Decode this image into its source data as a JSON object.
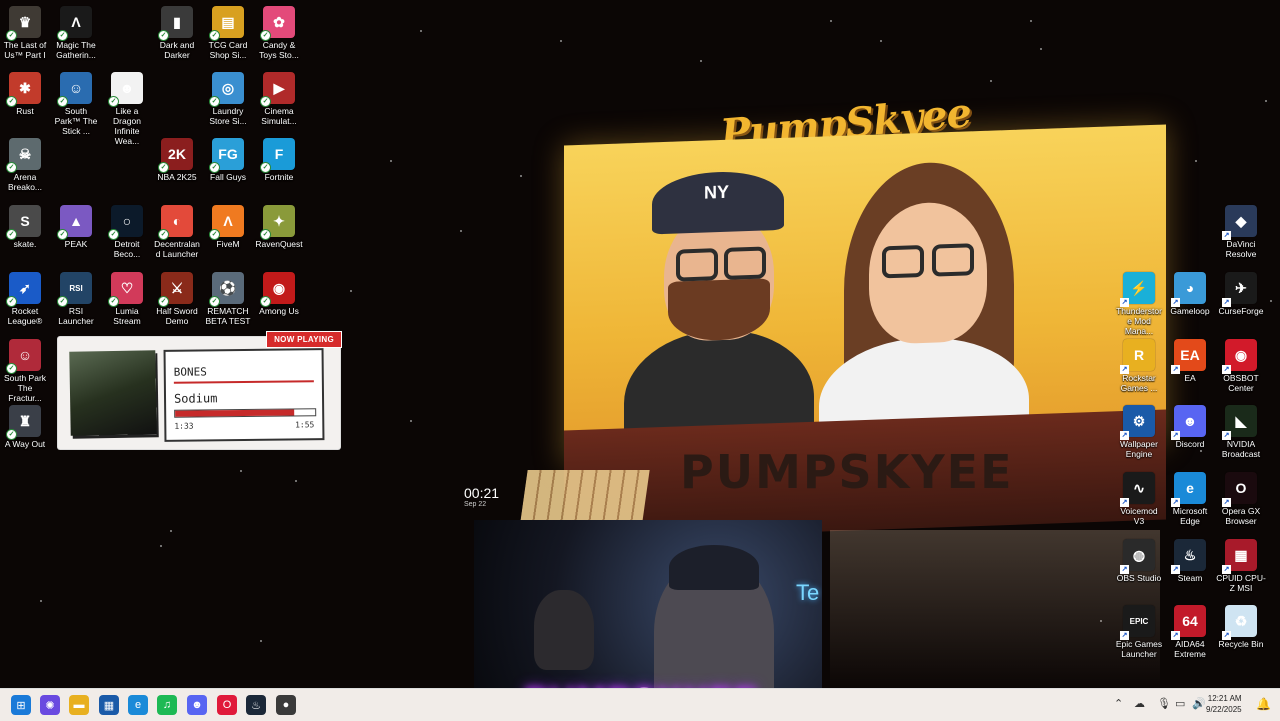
{
  "desktop": {
    "icons_left": [
      {
        "id": "tlou",
        "label": "The Last of Us™ Part I",
        "color": "#3f3a34",
        "glyph": "♛"
      },
      {
        "id": "magic",
        "label": "Magic The Gatherin...",
        "color": "#1a1a1a",
        "glyph": "Λ"
      },
      {
        "id": "dark",
        "label": "Dark and Darker",
        "color": "#3a3a3a",
        "glyph": "▮"
      },
      {
        "id": "tcg",
        "label": "TCG Card Shop Si...",
        "color": "#d8a020",
        "glyph": "▤"
      },
      {
        "id": "candy",
        "label": "Candy & Toys Sto...",
        "color": "#e34a7a",
        "glyph": "✿"
      },
      {
        "id": "rust",
        "label": "Rust",
        "color": "#c23b2b",
        "glyph": "✱"
      },
      {
        "id": "southpark",
        "label": "South Park™ The Stick ...",
        "color": "#2a6cb0",
        "glyph": "☺"
      },
      {
        "id": "dragon",
        "label": "Like a Dragon Infinite Wea...",
        "color": "#f2f2f2",
        "glyph": "☻"
      },
      {
        "id": "laundry",
        "label": "Laundry Store Si...",
        "color": "#3a8fd0",
        "glyph": "◎"
      },
      {
        "id": "cinema",
        "label": "Cinema Simulat...",
        "color": "#b02a2a",
        "glyph": "▶"
      },
      {
        "id": "arena",
        "label": "Arena Breako...",
        "color": "#5d6a6e",
        "glyph": "☠"
      },
      {
        "id": "nba",
        "label": "NBA 2K25",
        "color": "#8b1e1e",
        "glyph": "2K"
      },
      {
        "id": "fallguys",
        "label": "Fall Guys",
        "color": "#2a9fd8",
        "glyph": "FG"
      },
      {
        "id": "fortnite",
        "label": "Fortnite",
        "color": "#1a9bd8",
        "glyph": "F"
      },
      {
        "id": "skate",
        "label": "skate.",
        "color": "#4a4a4a",
        "glyph": "S"
      },
      {
        "id": "peak",
        "label": "PEAK",
        "color": "#7b59c2",
        "glyph": "▲"
      },
      {
        "id": "detroit",
        "label": "Detroit Beco...",
        "color": "#0c1a2a",
        "glyph": "○"
      },
      {
        "id": "decentraland",
        "label": "Decentraland Launcher",
        "color": "#e34a3a",
        "glyph": "◐"
      },
      {
        "id": "fivem",
        "label": "FiveM",
        "color": "#f07a20",
        "glyph": "Λ"
      },
      {
        "id": "ravenquest",
        "label": "RavenQuest",
        "color": "#8a9a3a",
        "glyph": "✦"
      },
      {
        "id": "rocket",
        "label": "Rocket League®",
        "color": "#1a5bc8",
        "glyph": "➶"
      },
      {
        "id": "rsi",
        "label": "RSI Launcher",
        "color": "#224466",
        "glyph": "RSI"
      },
      {
        "id": "lumia",
        "label": "Lumia Stream",
        "color": "#d23a5a",
        "glyph": "♡"
      },
      {
        "id": "halfsword",
        "label": "Half Sword Demo",
        "color": "#8a2a1a",
        "glyph": "⚔"
      },
      {
        "id": "rematch",
        "label": "REMATCH BETA TEST",
        "color": "#5a6a7a",
        "glyph": "⚽"
      },
      {
        "id": "amongus",
        "label": "Among Us",
        "color": "#c21a1a",
        "glyph": "◉"
      },
      {
        "id": "southpark2",
        "label": "South Park The Fractur...",
        "color": "#b02a3a",
        "glyph": "☺"
      },
      {
        "id": "awayout",
        "label": "A Way Out",
        "color": "#3a3f48",
        "glyph": "♜"
      }
    ],
    "icons_right": [
      {
        "id": "davinci",
        "label": "DaVinci Resolve",
        "color": "#2a3a5a",
        "glyph": "◆"
      },
      {
        "id": "thunderstore",
        "label": "Thunderstore Mod Mana...",
        "color": "#1ab0d8",
        "glyph": "⚡"
      },
      {
        "id": "gameloop",
        "label": "Gameloop",
        "color": "#3a9ad8",
        "glyph": "◕"
      },
      {
        "id": "curseforge",
        "label": "CurseForge",
        "color": "#1a1a1a",
        "glyph": "✈"
      },
      {
        "id": "rockstar",
        "label": "Rockstar Games ...",
        "color": "#e8b020",
        "glyph": "R"
      },
      {
        "id": "ea",
        "label": "EA",
        "color": "#e34a1a",
        "glyph": "EA"
      },
      {
        "id": "obsbot",
        "label": "OBSBOT Center",
        "color": "#d21a2a",
        "glyph": "◉"
      },
      {
        "id": "wallpaper",
        "label": "Wallpaper Engine",
        "color": "#1a5aa8",
        "glyph": "⚙"
      },
      {
        "id": "discord",
        "label": "Discord",
        "color": "#5865f2",
        "glyph": "☻"
      },
      {
        "id": "nvidia",
        "label": "NVIDIA Broadcast",
        "color": "#1a2a1a",
        "glyph": "◣"
      },
      {
        "id": "voicemod",
        "label": "Voicemod V3",
        "color": "#1a1a1a",
        "glyph": "∿"
      },
      {
        "id": "edge",
        "label": "Microsoft Edge",
        "color": "#1a8ad8",
        "glyph": "e"
      },
      {
        "id": "operagx",
        "label": "Opera GX Browser",
        "color": "#1a0a0e",
        "glyph": "O"
      },
      {
        "id": "obs",
        "label": "OBS Studio",
        "color": "#2a2a2a",
        "glyph": "◍"
      },
      {
        "id": "steam",
        "label": "Steam",
        "color": "#1b2838",
        "glyph": "♨"
      },
      {
        "id": "cpuz",
        "label": "CPUID CPU-Z MSI",
        "color": "#a81a2a",
        "glyph": "▦"
      },
      {
        "id": "epic",
        "label": "Epic Games Launcher",
        "color": "#1a1a1a",
        "glyph": "EPIC"
      },
      {
        "id": "aida",
        "label": "AIDA64 Extreme",
        "color": "#c21a2a",
        "glyph": "64"
      },
      {
        "id": "recycle",
        "label": "Recycle Bin",
        "color": "#cfe4f2",
        "glyph": "♻"
      }
    ]
  },
  "now_playing": {
    "badge": "NOW PLAYING",
    "track": "BONES",
    "artist": "Sodium",
    "elapsed": "1:33",
    "total": "1:55",
    "progress": 0.85
  },
  "wallpaper": {
    "logo_top": "PumpSkyee",
    "desk_text": "PUMPSKYEE",
    "cap_letters": "NY"
  },
  "clock_widget": {
    "time": "00:21",
    "date": "Sep 22"
  },
  "webcam": {
    "brand": "PUMPSKYEE",
    "neon": "Te"
  },
  "taskbar": {
    "apps": [
      {
        "id": "start",
        "icon": "windows-start-icon",
        "color": "#1a7ad8",
        "glyph": "⊞"
      },
      {
        "id": "copilot",
        "icon": "copilot-icon",
        "color": "#6a4ae0",
        "glyph": "✺"
      },
      {
        "id": "explorer",
        "icon": "file-explorer-icon",
        "color": "#e8b020",
        "glyph": "▬"
      },
      {
        "id": "store",
        "icon": "store-icon",
        "color": "#1a5aa8",
        "glyph": "▦"
      },
      {
        "id": "edge",
        "icon": "edge-icon",
        "color": "#1a8ad8",
        "glyph": "e"
      },
      {
        "id": "spotify",
        "icon": "spotify-icon",
        "color": "#1db954",
        "glyph": "♫"
      },
      {
        "id": "discord",
        "icon": "discord-icon",
        "color": "#5865f2",
        "glyph": "☻"
      },
      {
        "id": "opera",
        "icon": "opera-gx-icon",
        "color": "#e01a3a",
        "glyph": "O"
      },
      {
        "id": "steam",
        "icon": "steam-icon",
        "color": "#1b2838",
        "glyph": "♨"
      },
      {
        "id": "other",
        "icon": "app-icon",
        "color": "#3a3a3a",
        "glyph": "●"
      }
    ],
    "time": "12:21 AM",
    "date": "9/22/2025"
  }
}
